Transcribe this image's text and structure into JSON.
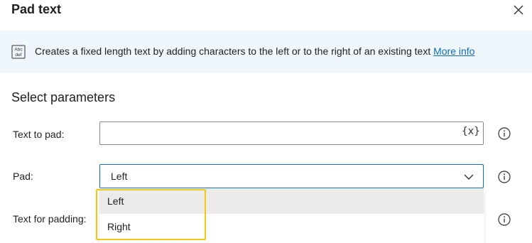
{
  "dialog": {
    "title": "Pad text",
    "close_icon": "close-icon"
  },
  "banner": {
    "icon": "text-abc-def-icon",
    "icon_top": "Abc",
    "icon_bottom": "def",
    "description": "Creates a fixed length text by adding characters to the left or to the right of an existing text",
    "link_label": "More info",
    "background": "#eff6fc",
    "link_color": "#0f6cbd"
  },
  "parameters": {
    "section_title": "Select parameters",
    "text_to_pad": {
      "label": "Text to pad:",
      "value": "",
      "variable_button": "{x}",
      "info_icon": "info-icon"
    },
    "pad": {
      "label": "Pad:",
      "selected": "Left",
      "options": [
        "Left",
        "Right"
      ],
      "highlighted_option": "Left",
      "info_icon": "info-icon"
    },
    "text_for_padding": {
      "label": "Text for padding:",
      "info_icon": "info-icon"
    }
  },
  "colors": {
    "focus_border": "#0f6cbd",
    "annotation_highlight": "#f2c811"
  }
}
